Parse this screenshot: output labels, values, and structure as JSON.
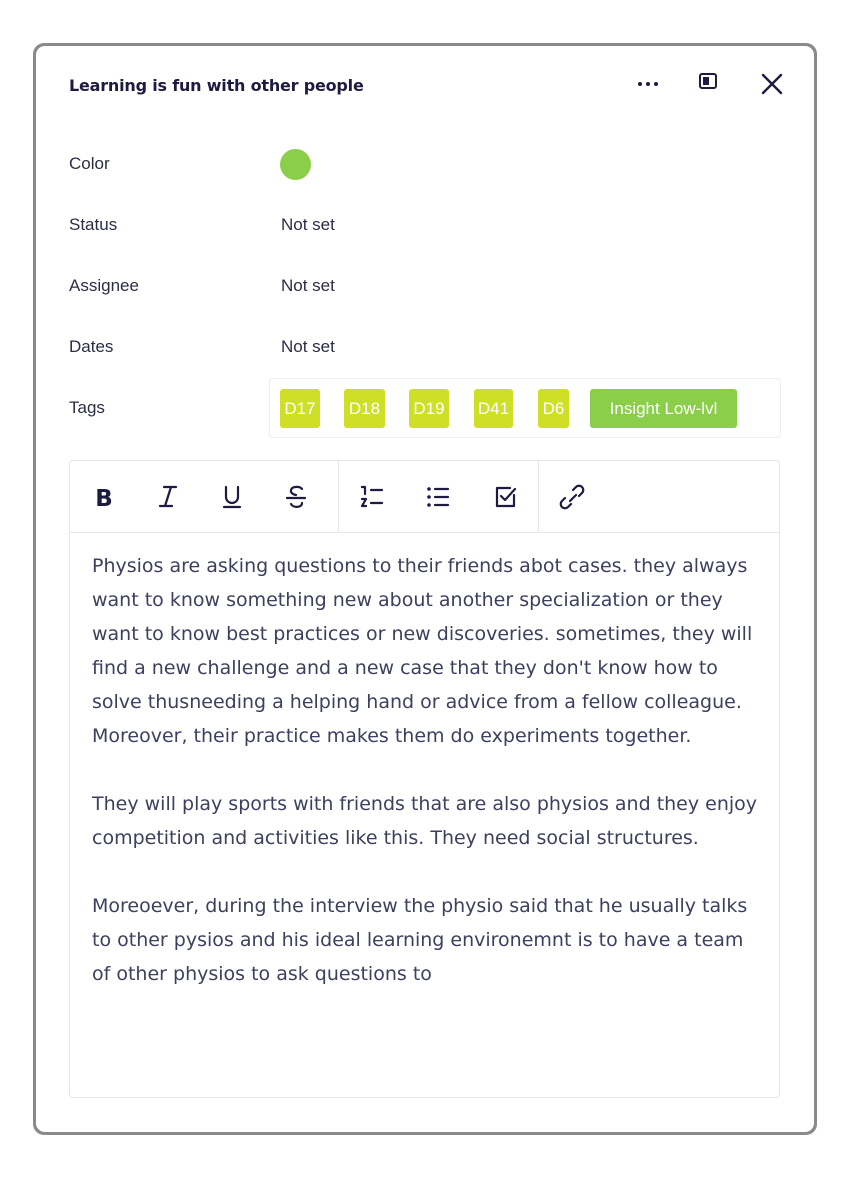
{
  "card": {
    "title": "Learning is fun with other people",
    "properties": {
      "color_label": "Color",
      "color_value": "#8bce4a",
      "status_label": "Status",
      "status_value": "Not set",
      "assignee_label": "Assignee",
      "assignee_value": "Not set",
      "dates_label": "Dates",
      "dates_value": "Not set",
      "tags_label": "Tags"
    },
    "tags": [
      {
        "label": "D17",
        "color": "#cde026"
      },
      {
        "label": "D18",
        "color": "#cde026"
      },
      {
        "label": "D19",
        "color": "#cde026"
      },
      {
        "label": "D41",
        "color": "#cde026"
      },
      {
        "label": "D6",
        "color": "#cde026"
      },
      {
        "label": "Insight Low-lvl",
        "color": "#8bce4a"
      }
    ],
    "toolbar_icons": [
      "bold-icon",
      "italic-icon",
      "underline-icon",
      "strikethrough-icon",
      "numbered-list-icon",
      "bulleted-list-icon",
      "checklist-icon",
      "link-icon"
    ],
    "body": [
      "Physios are asking questions to their friends abot cases. they always want to know something new about another specialization or they want to know best practices or new discoveries. sometimes, they will find a new challenge and a new case that they don't know how to solve thusneeding a helping hand or advice from a fellow colleague. Moreover, their practice makes them do experiments together.",
      "They will play sports with friends that are also physios and they enjoy competition and activities like this. They need social structures.",
      "Moreoever, during the interview the physio said that he usually talks to other pysios and his ideal learning environemnt is to have a team of other physios to ask questions to"
    ]
  }
}
